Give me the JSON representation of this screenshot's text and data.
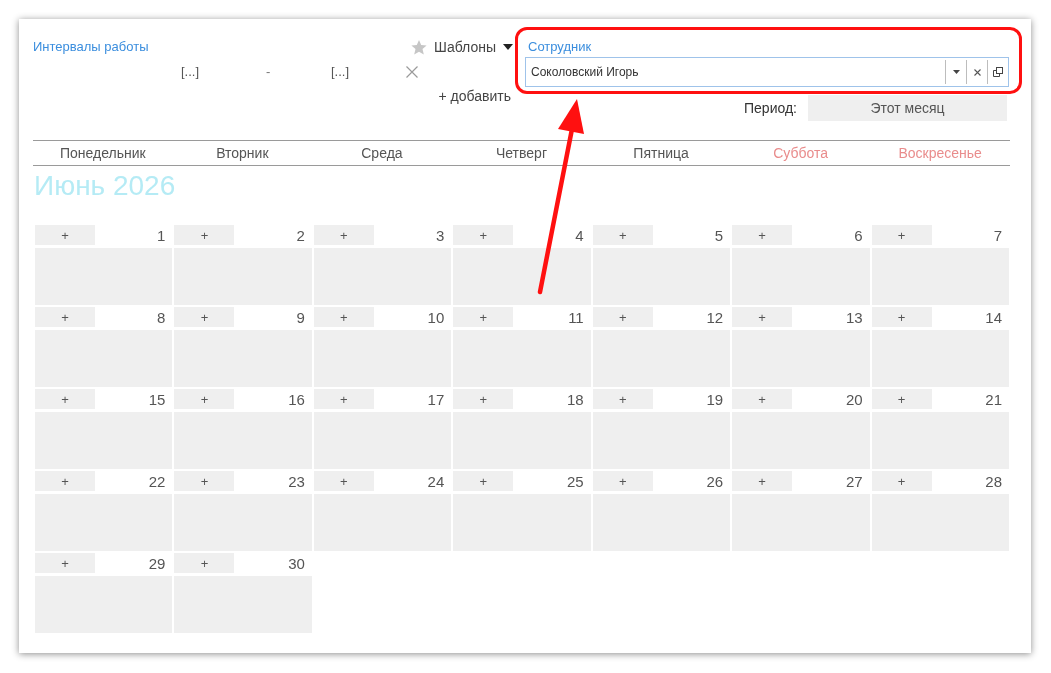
{
  "intervals": {
    "title": "Интервалы работы",
    "rows": [
      {
        "start": "[...]",
        "separator": "-",
        "end": "[...]"
      }
    ],
    "add": "+ добавить"
  },
  "templates": {
    "label": "Шаблоны"
  },
  "employee": {
    "label": "Сотрудник",
    "value": "Соколовский Игорь"
  },
  "period": {
    "label": "Период:",
    "value": "Этот месяц"
  },
  "weekdays": [
    {
      "label": "Понедельник",
      "weekend": false
    },
    {
      "label": "Вторник",
      "weekend": false
    },
    {
      "label": "Среда",
      "weekend": false
    },
    {
      "label": "Четверг",
      "weekend": false
    },
    {
      "label": "Пятница",
      "weekend": false
    },
    {
      "label": "Суббота",
      "weekend": true
    },
    {
      "label": "Воскресенье",
      "weekend": true
    }
  ],
  "month_title": "Июнь 2026",
  "days": [
    {
      "add": "+",
      "number": "1"
    },
    {
      "add": "+",
      "number": "2"
    },
    {
      "add": "+",
      "number": "3"
    },
    {
      "add": "+",
      "number": "4"
    },
    {
      "add": "+",
      "number": "5"
    },
    {
      "add": "+",
      "number": "6"
    },
    {
      "add": "+",
      "number": "7"
    },
    {
      "add": "+",
      "number": "8"
    },
    {
      "add": "+",
      "number": "9"
    },
    {
      "add": "+",
      "number": "10"
    },
    {
      "add": "+",
      "number": "11"
    },
    {
      "add": "+",
      "number": "12"
    },
    {
      "add": "+",
      "number": "13"
    },
    {
      "add": "+",
      "number": "14"
    },
    {
      "add": "+",
      "number": "15"
    },
    {
      "add": "+",
      "number": "16"
    },
    {
      "add": "+",
      "number": "17"
    },
    {
      "add": "+",
      "number": "18"
    },
    {
      "add": "+",
      "number": "19"
    },
    {
      "add": "+",
      "number": "20"
    },
    {
      "add": "+",
      "number": "21"
    },
    {
      "add": "+",
      "number": "22"
    },
    {
      "add": "+",
      "number": "23"
    },
    {
      "add": "+",
      "number": "24"
    },
    {
      "add": "+",
      "number": "25"
    },
    {
      "add": "+",
      "number": "26"
    },
    {
      "add": "+",
      "number": "27"
    },
    {
      "add": "+",
      "number": "28"
    },
    {
      "add": "+",
      "number": "29"
    },
    {
      "add": "+",
      "number": "30"
    }
  ]
}
